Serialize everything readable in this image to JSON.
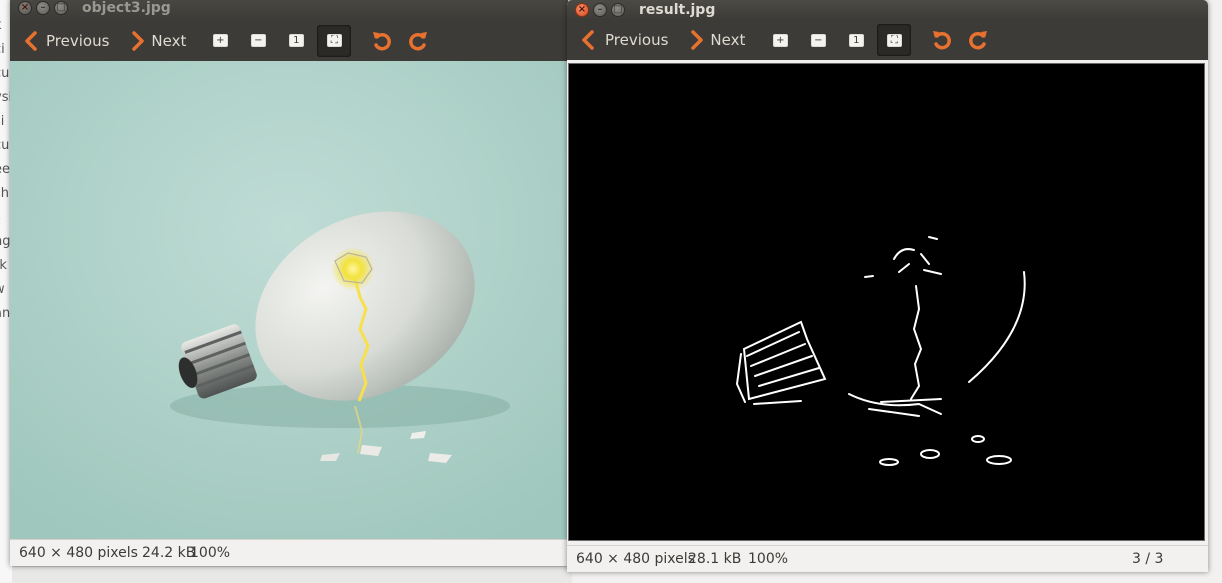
{
  "background_fragments": [
    "k",
    "ci",
    "cu",
    "vsi",
    "si",
    "cu",
    "ee",
    "sh",
    "s",
    "ng",
    "rk",
    "w",
    "an"
  ],
  "left_window": {
    "title": "object3.jpg",
    "toolbar": {
      "previous_label": "Previous",
      "next_label": "Next"
    },
    "status": {
      "dimensions": "640 × 480 pixels",
      "size": "24.2 kB",
      "zoom": "100%"
    }
  },
  "right_window": {
    "title": "result.jpg",
    "toolbar": {
      "previous_label": "Previous",
      "next_label": "Next"
    },
    "status": {
      "dimensions": "640 × 480 pixels",
      "size": "28.1 kB",
      "zoom": "100%",
      "position": "3 / 3"
    }
  },
  "icons": {
    "window_controls": [
      "close-icon",
      "minimize-icon",
      "maximize-icon"
    ],
    "toolbar": [
      "chevron-left-icon",
      "chevron-right-icon",
      "zoom-in-icon",
      "zoom-out-icon",
      "normal-size-icon",
      "best-fit-icon",
      "rotate-left-icon",
      "rotate-right-icon"
    ]
  },
  "colors": {
    "titlebar": "#3c3b37",
    "accent_orange": "#e8712f",
    "statusbar": "#f2f1f0",
    "photo_bg": "#a9cfc6"
  }
}
